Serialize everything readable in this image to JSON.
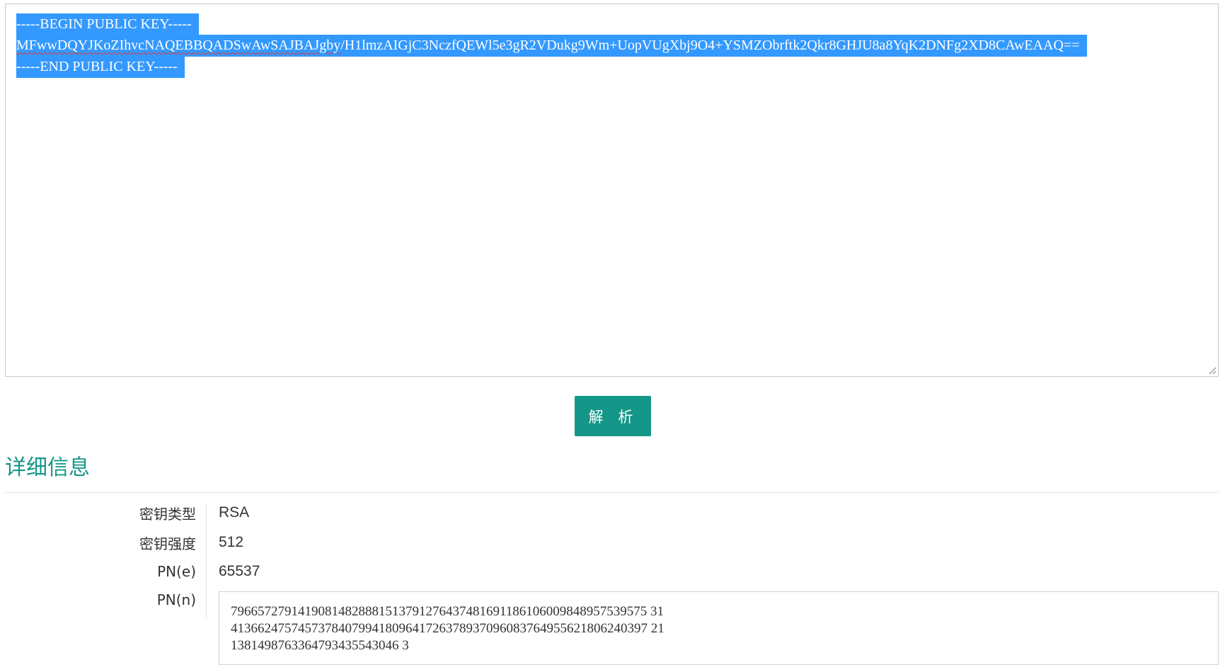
{
  "key_editor": {
    "lines": [
      "-----BEGIN PUBLIC KEY-----",
      "MFwwDQYJKoZIhvcNAQEBBQADSwAwSAJBAJgby/H1lmzAIGjC3NczfQEWl5e3gR2VDukg9Wm+UopVUgXbj9O4+YSMZObrftk2Qkr8GHJU8a8YqK2DNFg2XD8CAwEAAQ==",
      "-----END PUBLIC KEY-----"
    ],
    "key_line_prefix": "MFwwDQYJKoZIhvcNAQEBBQADSwAwSAJBAJgby",
    "key_line_rest": "/H1lmzAIGjC3NczfQEWl5e3gR2VDukg9Wm+UopVUgXbj9O4+YSMZObrftk2Qkr8GHJU8a8YqK2DNFg2XD8CAwEAAQ==",
    "selection_color": "#3399ff",
    "spellcheck_color": "#e53935"
  },
  "parse_button": {
    "label": "解 析",
    "color": "#149688"
  },
  "details": {
    "title": "详细信息",
    "title_color": "#149688",
    "rows": [
      {
        "label": "密钥类型",
        "value": "RSA"
      },
      {
        "label": "密钥强度",
        "value": "512"
      },
      {
        "label": "PN(e)",
        "value": "65537"
      }
    ],
    "modulus": {
      "label": "PN(n)",
      "lines": [
        "79665727914190814828881513791276437481691186106009848957539575 31",
        "41366247574573784079941809641726378937096083764955621806240397 21",
        "1381498763364793435543046 3"
      ]
    }
  }
}
